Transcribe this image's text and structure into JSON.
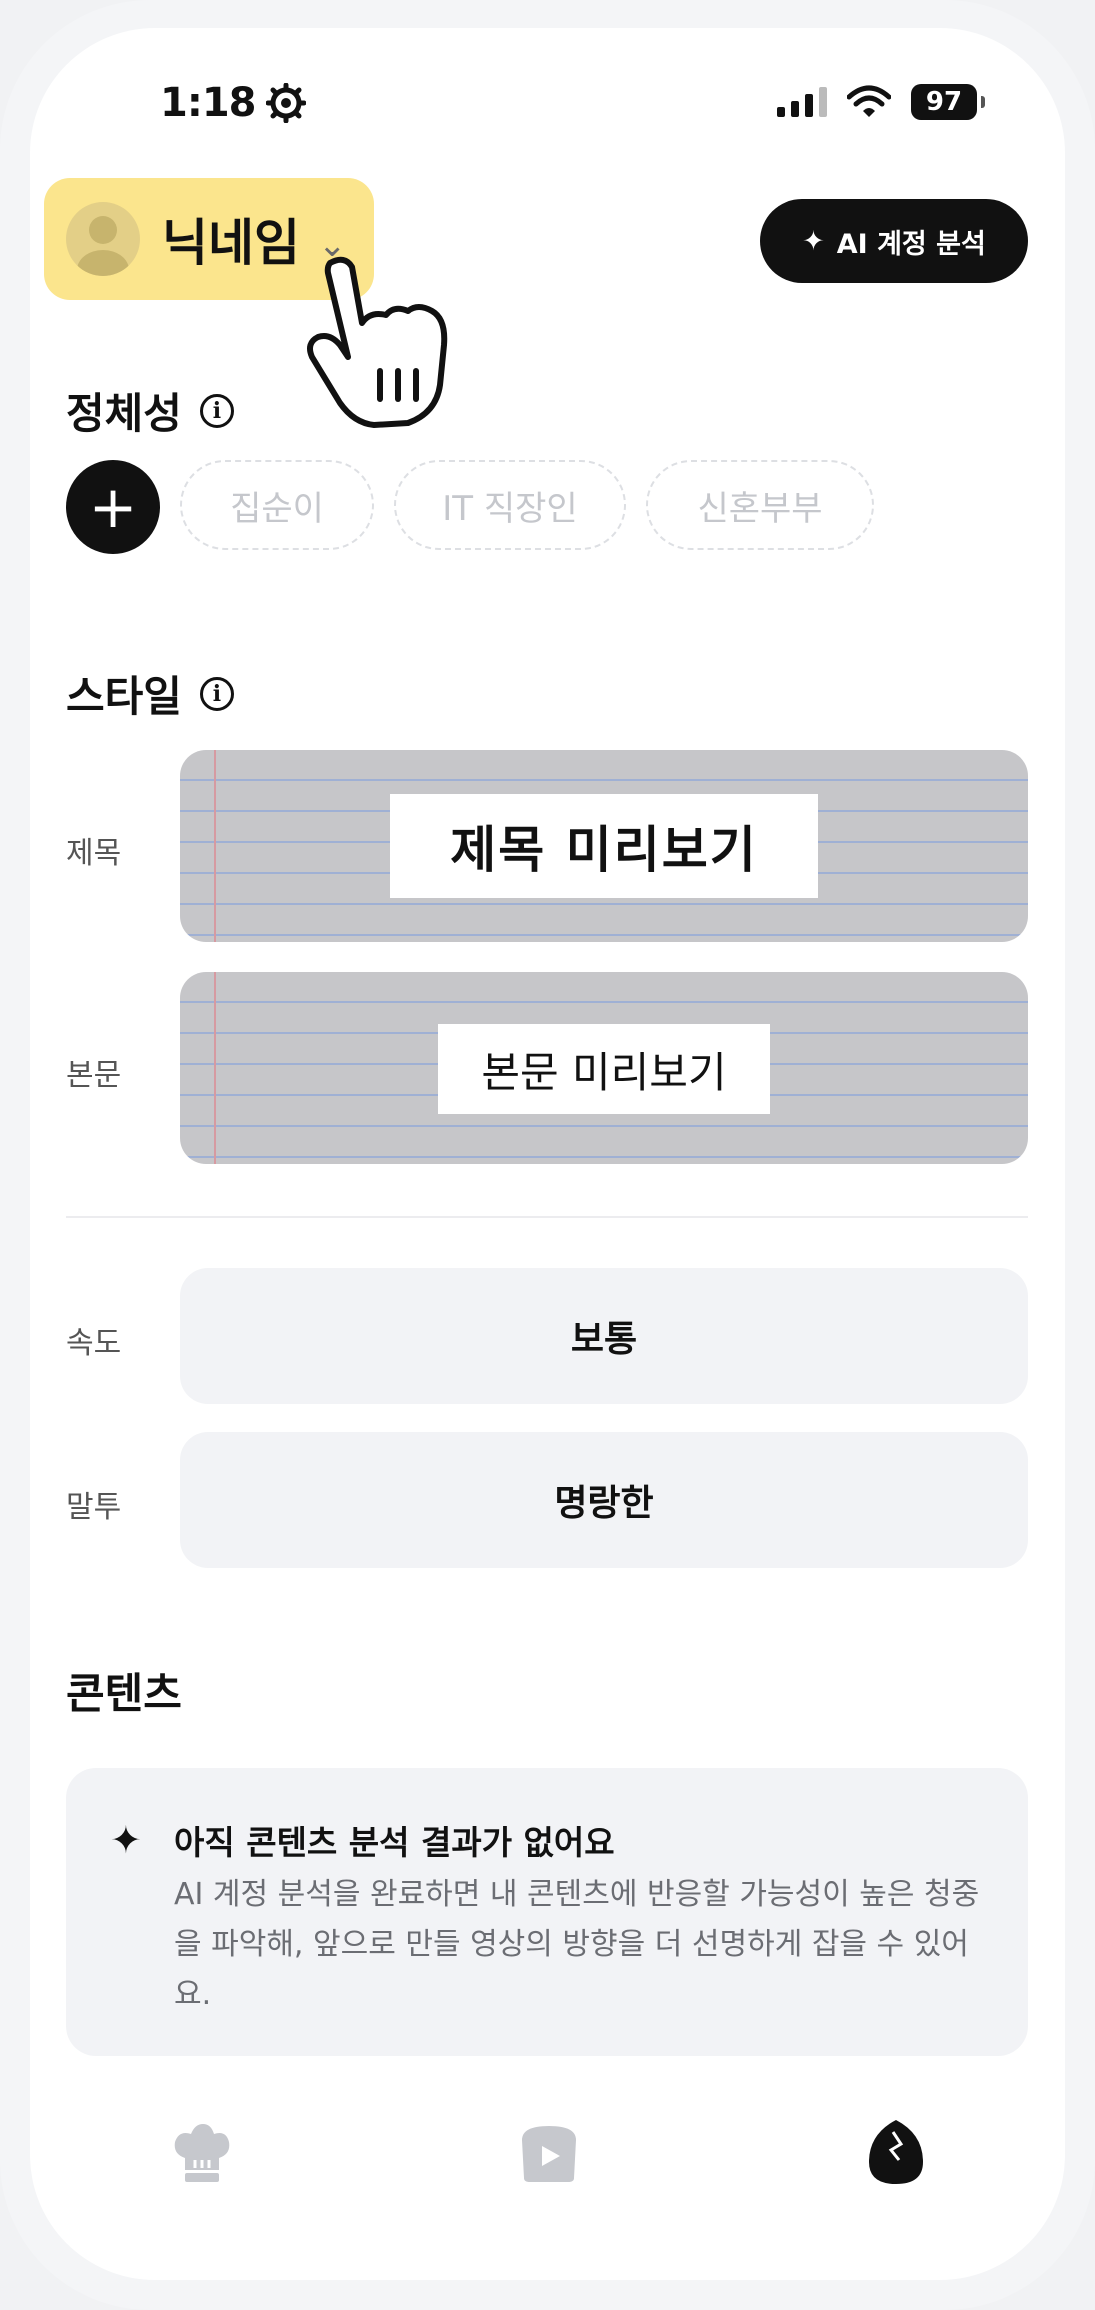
{
  "status_bar": {
    "time": "1:18",
    "battery": "97"
  },
  "header": {
    "nickname": "닉네임",
    "ai_button_label": "AI 계정 분석"
  },
  "identity": {
    "title": "정체성",
    "chips": [
      "집순이",
      "IT 직장인",
      "신혼부부"
    ]
  },
  "style": {
    "title": "스타일",
    "title_label": "제목",
    "title_preview": "제목 미리보기",
    "body_label": "본문",
    "body_preview": "본문 미리보기",
    "speed_label": "속도",
    "speed_value": "보통",
    "tone_label": "말투",
    "tone_value": "명랑한"
  },
  "content": {
    "title": "콘텐츠",
    "empty_heading": "아직 콘텐츠 분석 결과가 없어요",
    "empty_body": "AI 계정 분석을 완료하면 내 콘텐츠에 반응할 가능성이 높은 청중을 파악해, 앞으로 만들 영상의 방향을 더 선명하게 잡을 수 있어요."
  },
  "tabbar": {
    "tabs": [
      {
        "icon": "chef-hat-icon",
        "active": false
      },
      {
        "icon": "video-icon",
        "active": false
      },
      {
        "icon": "egg-icon",
        "active": true
      }
    ]
  },
  "colors": {
    "highlight": "#fbe58d",
    "primary": "#111111",
    "muted": "#c5c7cc",
    "card": "#f2f3f6"
  }
}
